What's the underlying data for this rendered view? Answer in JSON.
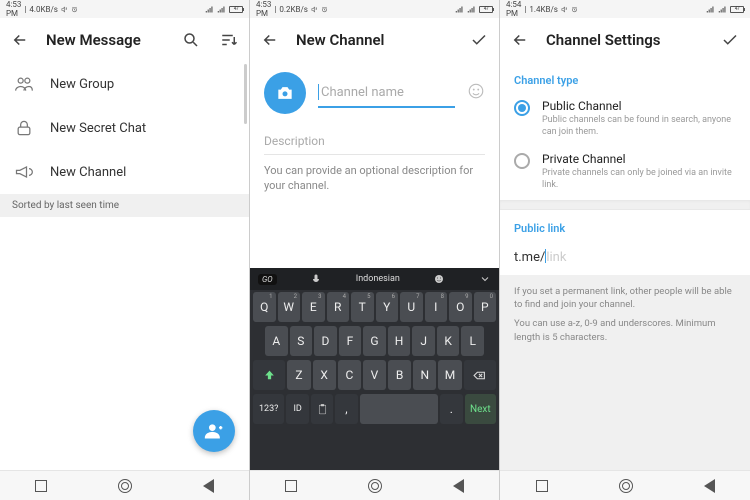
{
  "screen1": {
    "status": {
      "time": "4:53 PM",
      "net": "4.0KB/s",
      "battery": "47"
    },
    "title": "New Message",
    "items": [
      {
        "label": "New Group"
      },
      {
        "label": "New Secret Chat"
      },
      {
        "label": "New Channel"
      }
    ],
    "sorted": "Sorted by last seen time"
  },
  "screen2": {
    "status": {
      "time": "4:53 PM",
      "net": "0.2KB/s",
      "battery": "47"
    },
    "title": "New Channel",
    "name_placeholder": "Channel name",
    "desc_label": "Description",
    "desc_hint": "You can provide an optional description for your channel.",
    "keyboard": {
      "lang": "Indonesian",
      "row1": [
        "Q",
        "W",
        "E",
        "R",
        "T",
        "Y",
        "U",
        "I",
        "O",
        "P"
      ],
      "nums": [
        "1",
        "2",
        "3",
        "4",
        "5",
        "6",
        "7",
        "8",
        "9",
        "0"
      ],
      "row2": [
        "A",
        "S",
        "D",
        "F",
        "G",
        "H",
        "J",
        "K",
        "L"
      ],
      "row3": [
        "Z",
        "X",
        "C",
        "V",
        "B",
        "N",
        "M"
      ],
      "bottom": {
        "sym": "123?",
        "id": "ID",
        "next": "Next"
      }
    }
  },
  "screen3": {
    "status": {
      "time": "4:54 PM",
      "net": "1.4KB/s",
      "battery": "47"
    },
    "title": "Channel Settings",
    "type_header": "Channel type",
    "public_label": "Public Channel",
    "public_desc": "Public channels can be found in search, anyone can join them.",
    "private_label": "Private Channel",
    "private_desc": "Private channels can only be joined via an invite link.",
    "link_header": "Public link",
    "link_prefix": "t.me/",
    "link_placeholder": "link",
    "info1": "If you set a permanent link, other people will be able to find and join your channel.",
    "info2": "You can use a-z, 0-9 and underscores. Minimum length is 5 characters."
  }
}
